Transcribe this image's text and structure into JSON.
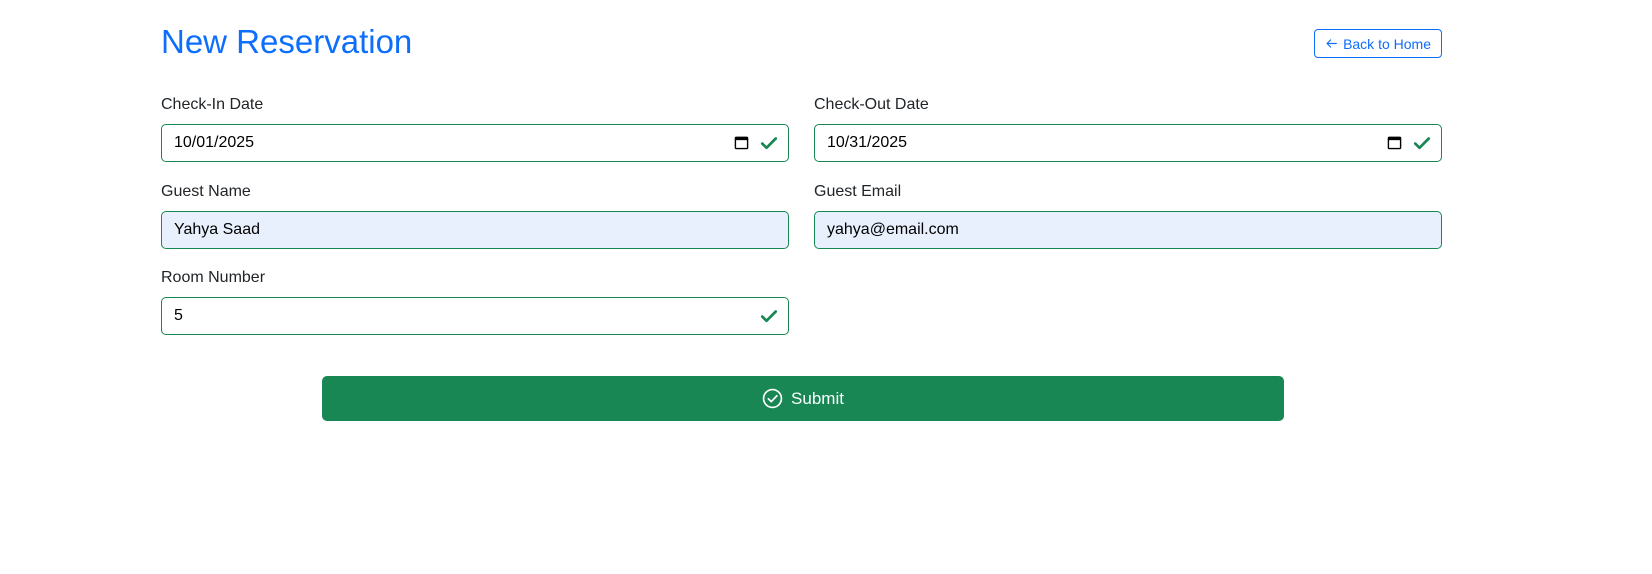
{
  "header": {
    "title": "New Reservation",
    "back_label": "Back to Home",
    "back_icon": "arrow-left-icon"
  },
  "form": {
    "check_in": {
      "label": "Check-In Date",
      "value": "10/01/2025",
      "icon": "calendar-icon",
      "valid": true
    },
    "check_out": {
      "label": "Check-Out Date",
      "value": "10/31/2025",
      "icon": "calendar-icon",
      "valid": true
    },
    "guest_name": {
      "label": "Guest Name",
      "value": "Yahya Saad",
      "autofilled": true
    },
    "guest_email": {
      "label": "Guest Email",
      "value": "yahya@email.com",
      "autofilled": true
    },
    "room_number": {
      "label": "Room Number",
      "value": "5",
      "valid": true
    }
  },
  "submit": {
    "label": "Submit",
    "icon": "check-circle-icon"
  },
  "colors": {
    "primary": "#0d6efd",
    "success": "#198754",
    "autofill_bg": "#e8f0fe"
  }
}
